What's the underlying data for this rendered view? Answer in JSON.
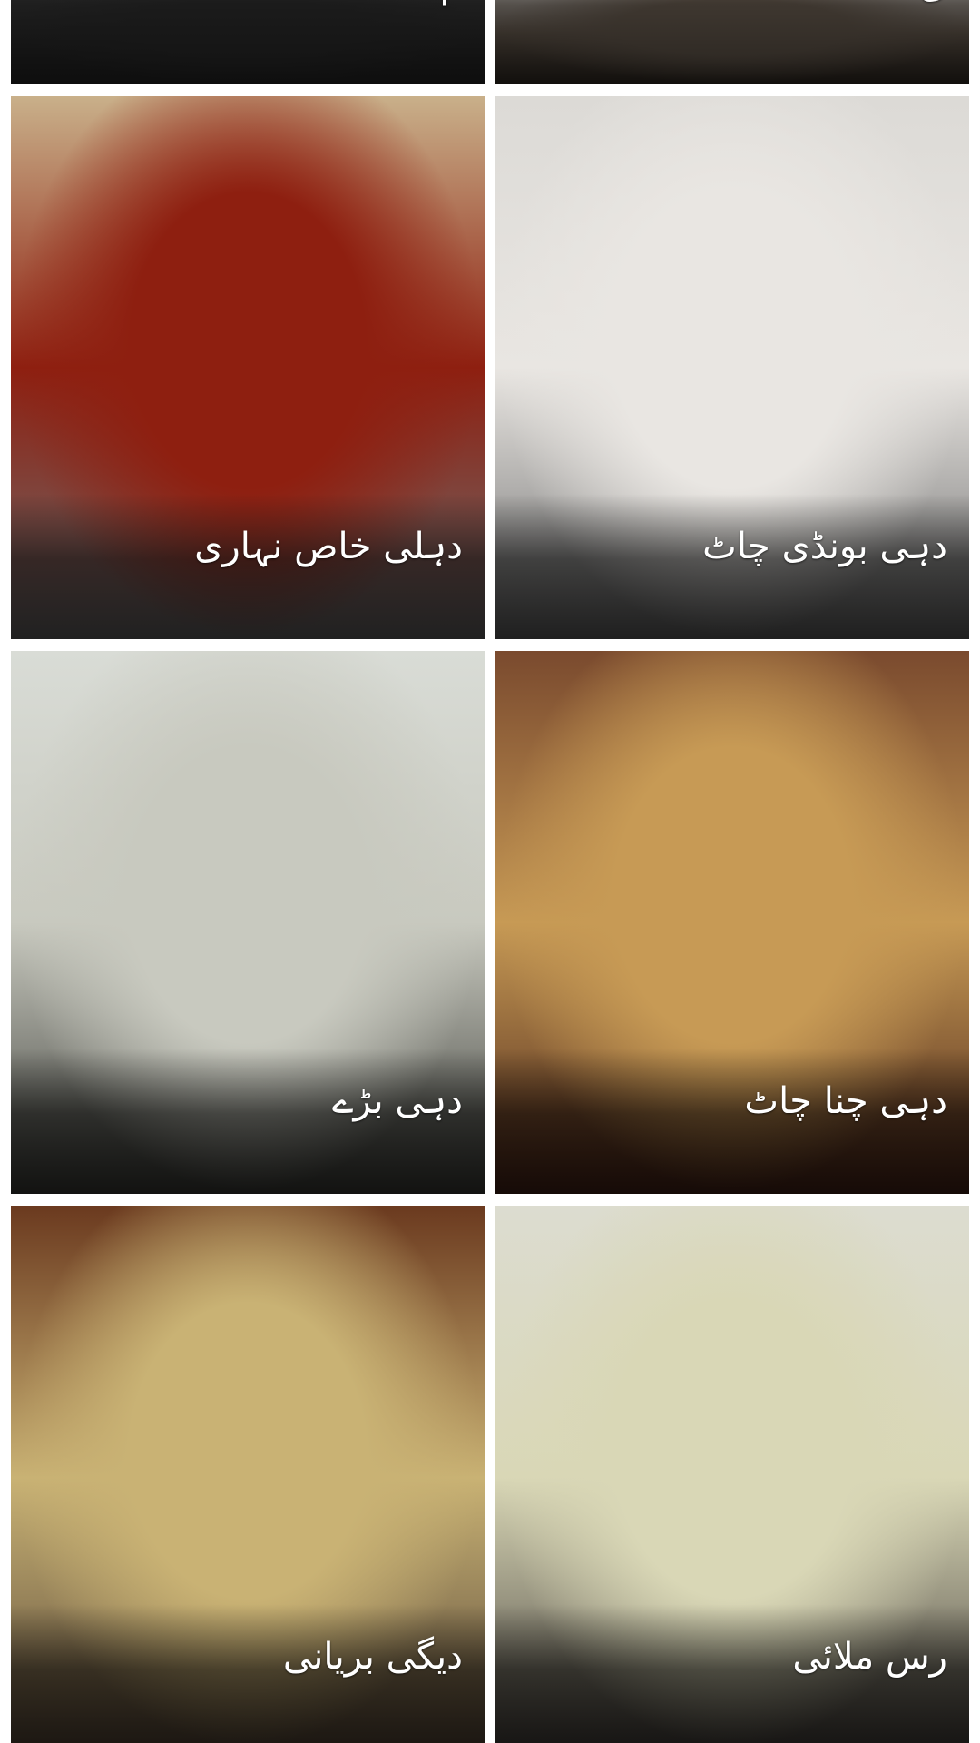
{
  "recipes": [
    {
      "title": "م",
      "colors": {
        "top": "#4a4a4a",
        "mid": "#3c3c3c",
        "bottom": "#2f2f2f"
      }
    },
    {
      "title": "ی",
      "colors": {
        "top": "#e8e2dc",
        "mid": "#8a7a6a",
        "bottom": "#3d342b"
      }
    },
    {
      "title": "دہلی خاص نہاری",
      "colors": {
        "top": "#c9b08a",
        "mid": "#8e1f10",
        "bottom": "#6e6e6e"
      }
    },
    {
      "title": "دہی بونڈی چاٹ",
      "colors": {
        "top": "#dcdad6",
        "mid": "#e9e6e2",
        "bottom": "#6a6a6a"
      }
    },
    {
      "title": "دہی بڑے",
      "colors": {
        "top": "#d9dcd6",
        "mid": "#c8c9bf",
        "bottom": "#3e3f3a"
      }
    },
    {
      "title": "دہی چنا چاٹ",
      "colors": {
        "top": "#7a4a2e",
        "mid": "#c79a55",
        "bottom": "#4a2418"
      }
    },
    {
      "title": "دیگی بریانی",
      "colors": {
        "top": "#6b3a1f",
        "mid": "#c9b274",
        "bottom": "#5a4a3a"
      }
    },
    {
      "title": "رس ملائی",
      "colors": {
        "top": "#dcdcd0",
        "mid": "#d9d7b6",
        "bottom": "#4a4540"
      }
    }
  ]
}
